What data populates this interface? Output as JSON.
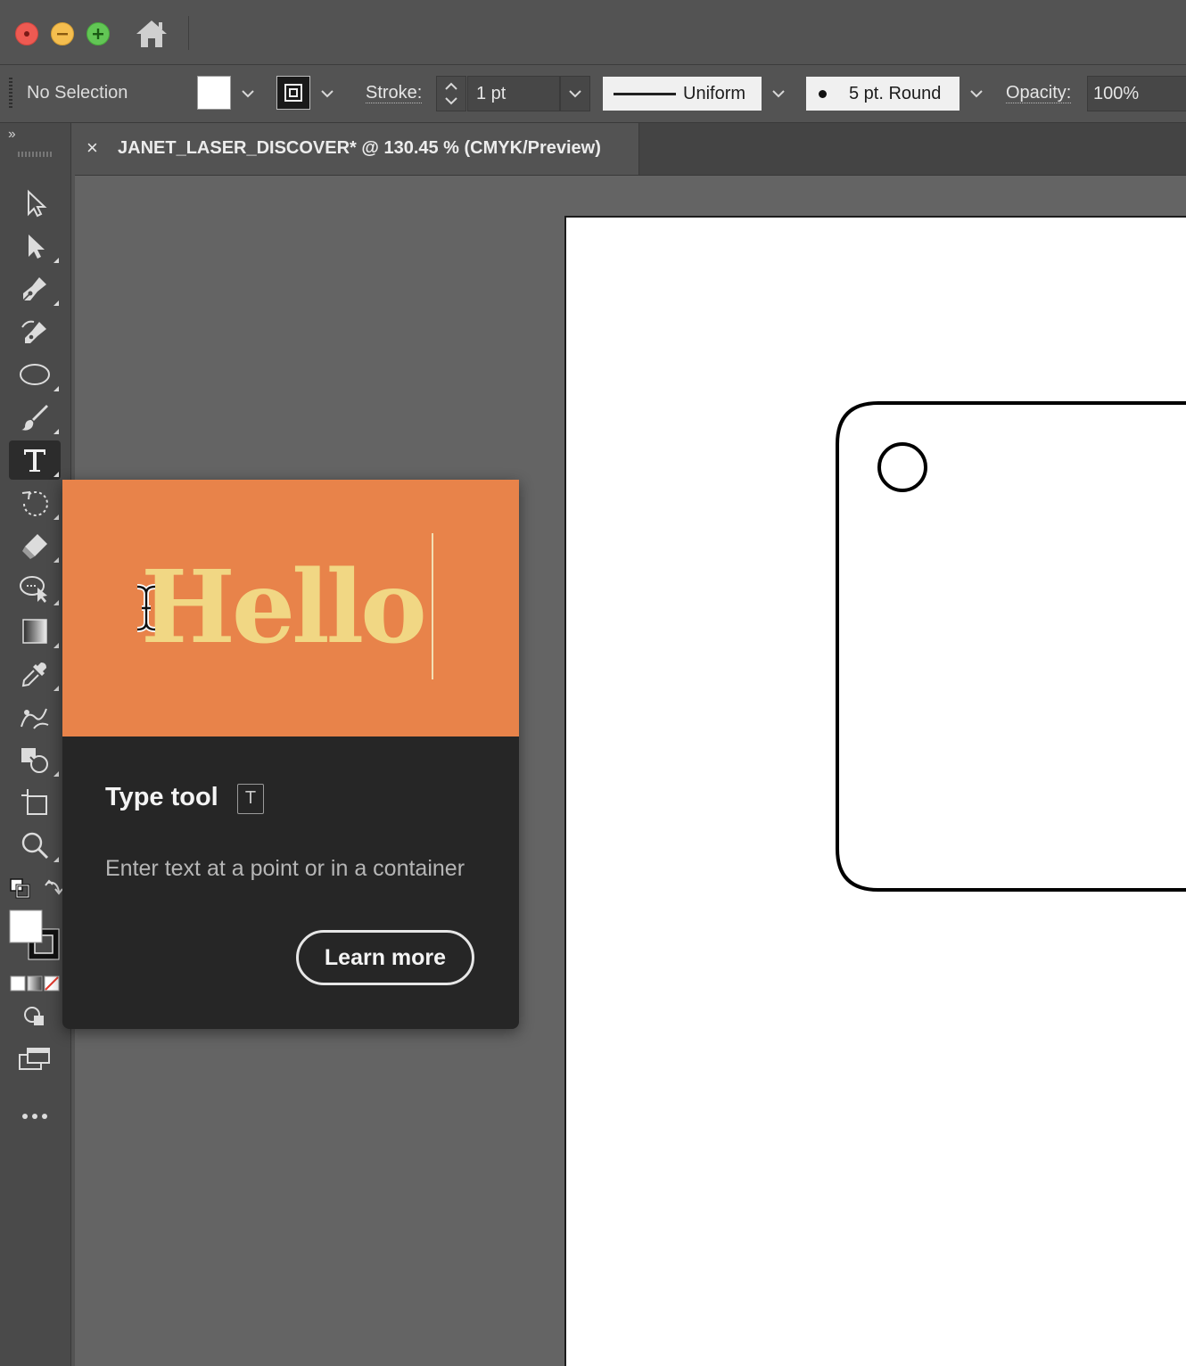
{
  "control_bar": {
    "selection_status": "No Selection",
    "stroke_label": "Stroke:",
    "stroke_weight": "1 pt",
    "variable_width_profile": "Uniform",
    "brush_definition": "5 pt. Round",
    "opacity_label": "Opacity:",
    "opacity_value": "100%"
  },
  "toolbar": {
    "collapse_glyph": "››"
  },
  "document_tab": {
    "close_glyph": "×",
    "title": "JANET_LASER_DISCOVER* @ 130.45 % (CMYK/Preview)"
  },
  "tool_tip": {
    "preview_text": "Hello",
    "title": "Type tool",
    "shortcut": "T",
    "description": "Enter text at a point or in a container",
    "learn_more": "Learn more",
    "banner_color": "#e8834a",
    "preview_text_color": "#f1d784"
  },
  "colors": {
    "fill": "#ffffff",
    "stroke": "#000000"
  }
}
